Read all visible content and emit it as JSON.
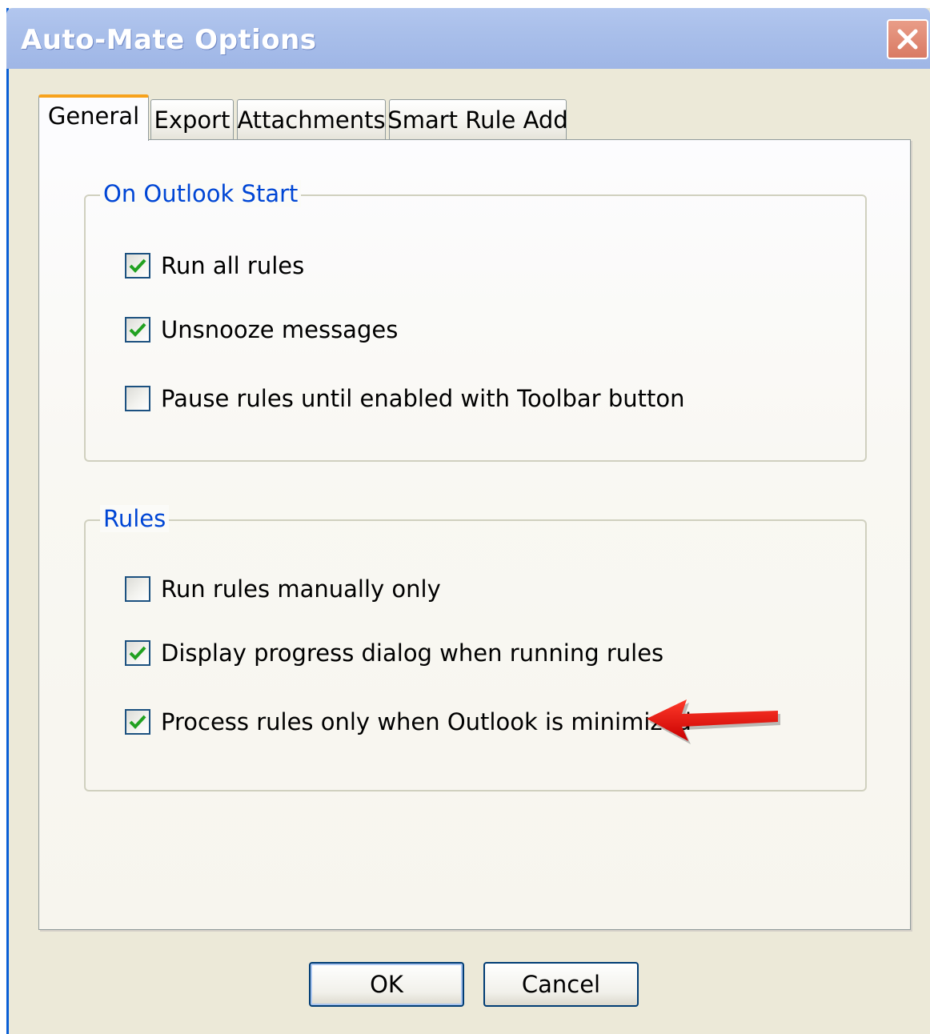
{
  "window": {
    "title": "Auto-Mate Options"
  },
  "tabs": [
    {
      "label": "General",
      "active": true
    },
    {
      "label": "Export",
      "active": false
    },
    {
      "label": "Attachments",
      "active": false
    },
    {
      "label": "Smart Rule Add",
      "active": false
    }
  ],
  "groups": {
    "outlook_start": {
      "legend": "On Outlook Start",
      "items": [
        {
          "label": "Run all rules",
          "checked": true
        },
        {
          "label": "Unsnooze messages",
          "checked": true
        },
        {
          "label": "Pause rules until enabled with Toolbar button",
          "checked": false
        }
      ]
    },
    "rules": {
      "legend": "Rules",
      "items": [
        {
          "label": "Run rules manually only",
          "checked": false
        },
        {
          "label": "Display progress dialog when running rules",
          "checked": true
        },
        {
          "label": "Process rules only when Outlook is minimized",
          "checked": true
        }
      ]
    }
  },
  "buttons": {
    "ok": "OK",
    "cancel": "Cancel"
  },
  "colors": {
    "accent_tab": "#f7a21c",
    "legend_text": "#0046d5",
    "check_green": "#21a121",
    "annotation_arrow": "#e60000"
  },
  "icons": {
    "close": "close-icon",
    "check": "checkmark-icon",
    "annotation": "red-arrow-icon"
  }
}
